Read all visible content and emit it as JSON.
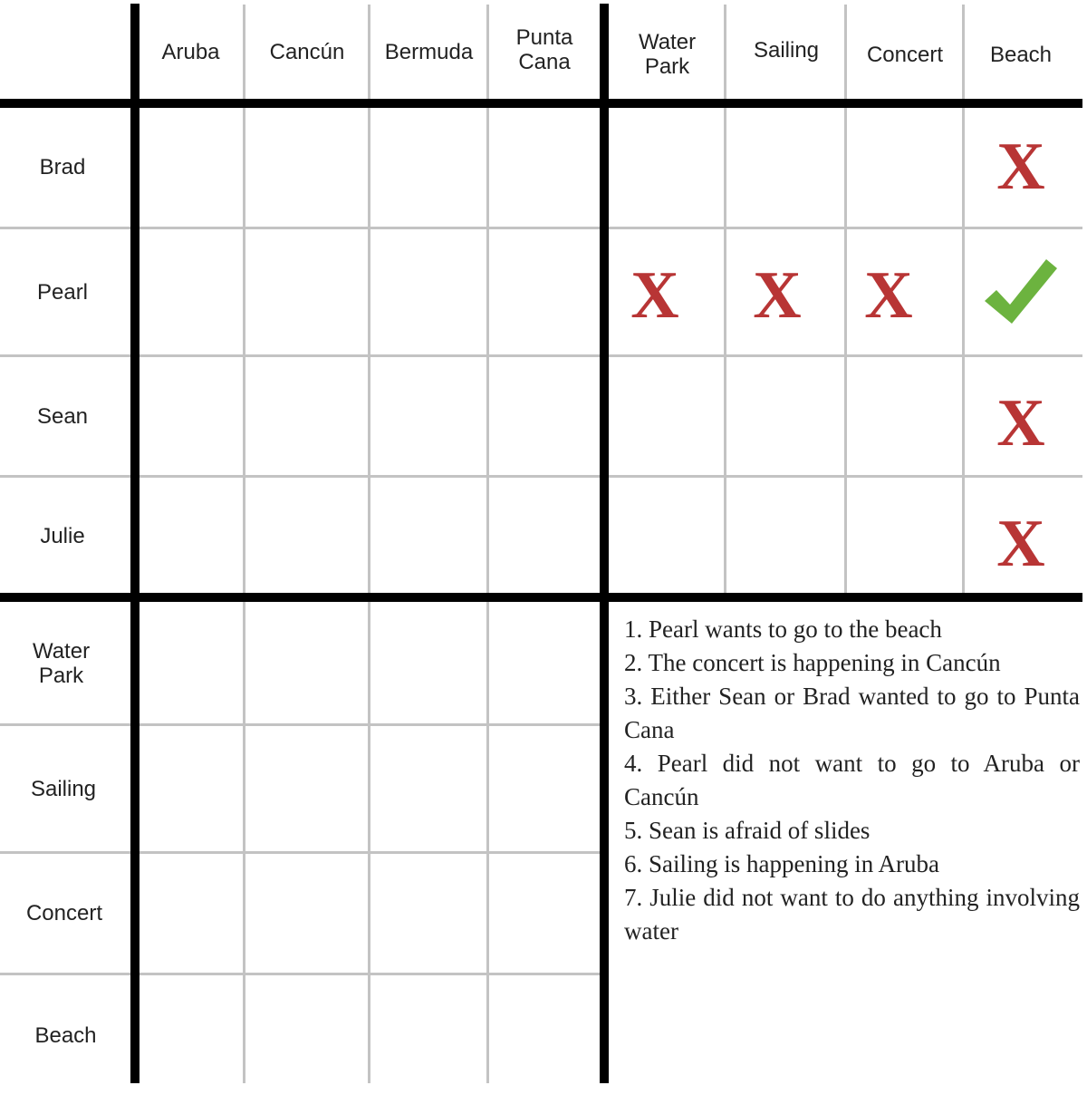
{
  "puzzle": {
    "columns_destinations": [
      "Aruba",
      "Cancún",
      "Bermuda",
      "Punta\nCana"
    ],
    "columns_activities": [
      "Water\nPark",
      "Sailing",
      "Concert",
      "Beach"
    ],
    "rows_people": [
      "Brad",
      "Pearl",
      "Sean",
      "Julie"
    ],
    "rows_activities": [
      "Water\nPark",
      "Sailing",
      "Concert",
      "Beach"
    ],
    "marks": [
      {
        "row": "Brad",
        "col": "Beach",
        "symbol": "x",
        "glyph": "X"
      },
      {
        "row": "Pearl",
        "col": "Water Park",
        "symbol": "x",
        "glyph": "X"
      },
      {
        "row": "Pearl",
        "col": "Sailing",
        "symbol": "x",
        "glyph": "X"
      },
      {
        "row": "Pearl",
        "col": "Concert",
        "symbol": "x",
        "glyph": "X"
      },
      {
        "row": "Pearl",
        "col": "Beach",
        "symbol": "check",
        "glyph": "check"
      },
      {
        "row": "Sean",
        "col": "Beach",
        "symbol": "x",
        "glyph": "X"
      },
      {
        "row": "Julie",
        "col": "Beach",
        "symbol": "x",
        "glyph": "X"
      }
    ],
    "colors": {
      "x_mark": "#b83535",
      "check_mark": "#6cb33f",
      "thick_line": "#000000",
      "thin_line": "#c3c3c3"
    }
  },
  "clues": [
    "1. Pearl wants to go to the beach",
    "2. The concert is happening in Cancún",
    "3. Either Sean or Brad wanted to go to Punta Cana",
    "4. Pearl did not want to go to Aruba or Cancún",
    "5. Sean is afraid of slides",
    "6. Sailing is happening in Aruba",
    "7. Julie did not want to do anything involving water"
  ]
}
